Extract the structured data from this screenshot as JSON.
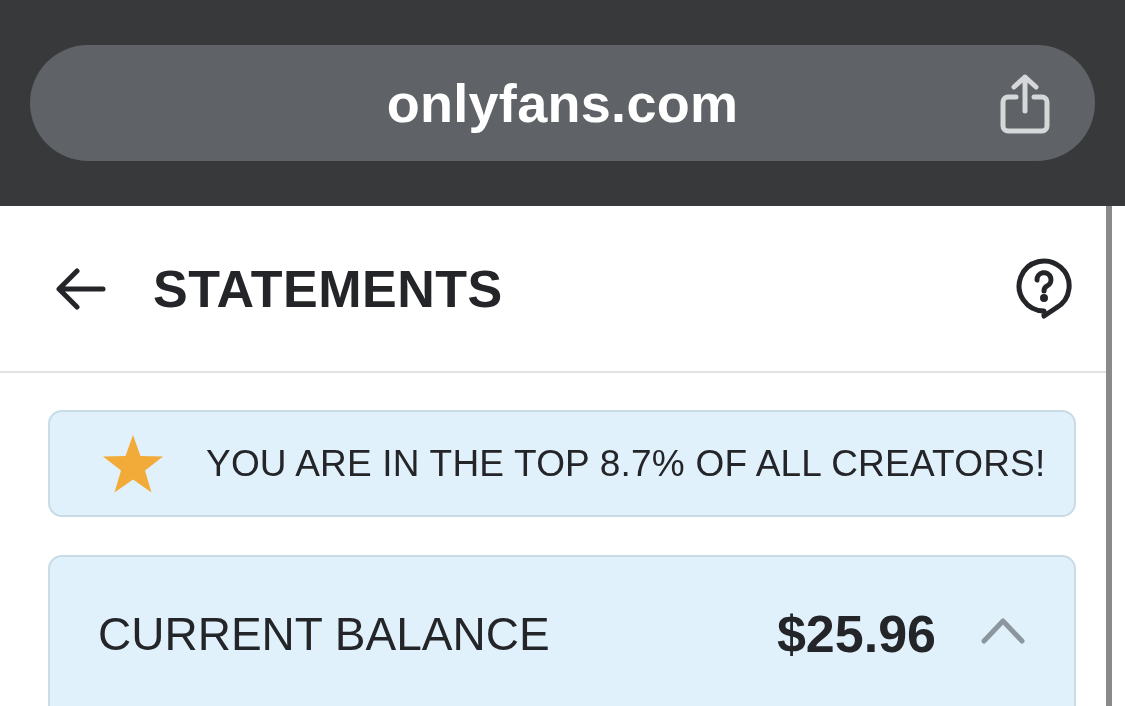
{
  "browser": {
    "url": "onlyfans.com"
  },
  "header": {
    "title": "STATEMENTS"
  },
  "banner": {
    "text": "YOU ARE IN THE TOP 8.7% OF ALL CREATORS!"
  },
  "balance": {
    "label": "CURRENT BALANCE",
    "amount": "$25.96",
    "expanded": true
  }
}
